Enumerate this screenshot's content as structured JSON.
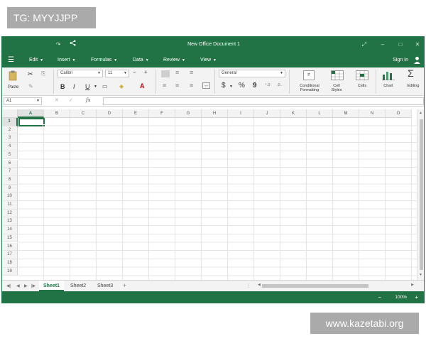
{
  "overlays": {
    "top_left": "TG: MYYJJPP",
    "bottom_right": "www.kazetabi.org"
  },
  "window": {
    "title": "New Office Document 1"
  },
  "menu": {
    "items": [
      "Edit",
      "Insert",
      "Formulas",
      "Data",
      "Review",
      "View"
    ],
    "signin": "Sign In"
  },
  "ribbon": {
    "paste_label": "Paste",
    "font_name": "Calibri",
    "font_size": "11",
    "number_format": "General",
    "bold": "B",
    "italic": "I",
    "underline": "U",
    "currency": "$",
    "percent": "%",
    "comma": "9",
    "conditional_formatting_line1": "Conditional",
    "conditional_formatting_line2": "Formatting",
    "cell_styles_line1": "Cell",
    "cell_styles_line2": "Styles",
    "cells_label": "Cells",
    "chart_label": "Chart",
    "editing_label": "Editing"
  },
  "formula_bar": {
    "name_box": "A1",
    "fx": "fx",
    "value": ""
  },
  "grid": {
    "columns": [
      "A",
      "B",
      "C",
      "D",
      "E",
      "F",
      "G",
      "H",
      "I",
      "J",
      "K",
      "L",
      "M",
      "N",
      "O"
    ],
    "rows": [
      "1",
      "2",
      "3",
      "4",
      "5",
      "6",
      "7",
      "8",
      "9",
      "10",
      "11",
      "12",
      "13",
      "14",
      "15",
      "16",
      "17",
      "18",
      "19"
    ],
    "active_cell": "A1"
  },
  "sheets": {
    "tabs": [
      "Sheet1",
      "Sheet2",
      "Sheet3"
    ],
    "active": "Sheet1",
    "add_symbol": "+"
  },
  "status": {
    "zoom": "100%",
    "zoom_minus": "−",
    "zoom_plus": "+"
  },
  "colors": {
    "accent": "#217346",
    "ribbon_bg": "#f3f3f3",
    "grid_line": "#e4e4e4"
  }
}
